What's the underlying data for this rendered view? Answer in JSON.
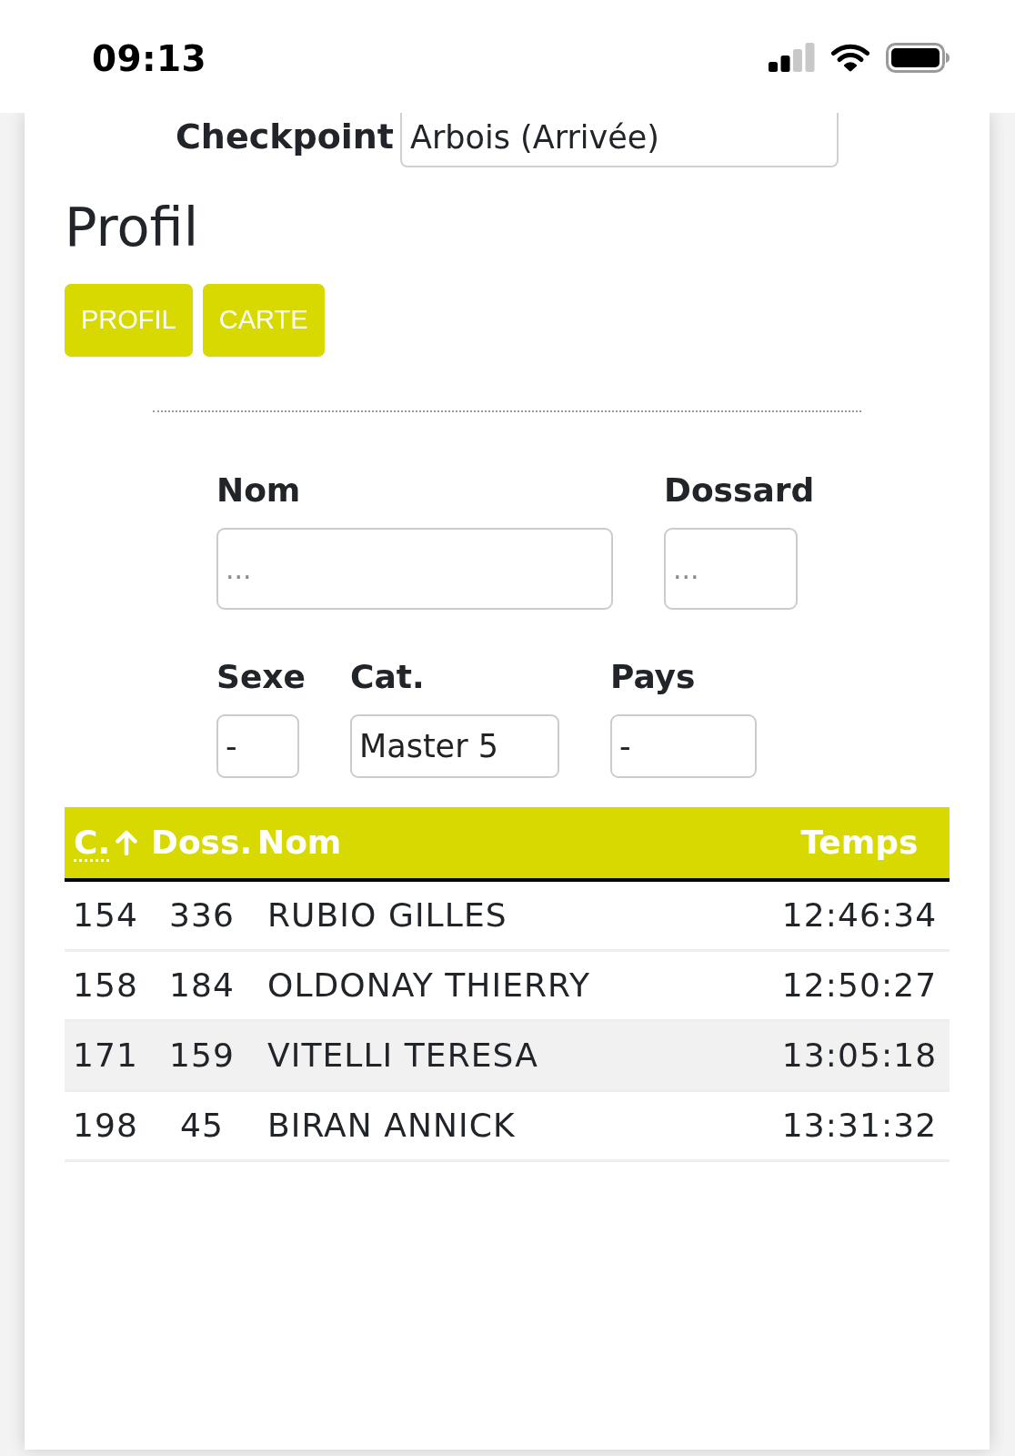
{
  "status_bar": {
    "time": "09:13"
  },
  "checkpoint": {
    "label": "Checkpoint",
    "value": "Arbois (Arrivée)"
  },
  "heading": "Profil",
  "view_buttons": [
    {
      "label": "PROFIL"
    },
    {
      "label": "CARTE"
    }
  ],
  "filters": [
    [
      {
        "kind": "input",
        "label": "Nom",
        "placeholder": "..."
      },
      {
        "kind": "input",
        "label": "Dossard",
        "placeholder": "..."
      }
    ],
    [
      {
        "kind": "select",
        "label": "Sexe",
        "value": "-"
      },
      {
        "kind": "select",
        "label": "Cat.",
        "value": "Master 5"
      },
      {
        "kind": "select",
        "label": "Pays",
        "value": "-"
      }
    ]
  ],
  "table": {
    "columns": [
      {
        "label": "C.",
        "abbr": true,
        "sorted": true
      },
      {
        "label": "Doss.",
        "abbr": false,
        "sorted": false
      },
      {
        "label": "Nom",
        "abbr": false,
        "sorted": false
      },
      {
        "label": "Temps",
        "abbr": false,
        "sorted": false
      }
    ],
    "rows": [
      {
        "cells": [
          "154",
          "336",
          "RUBIO GILLES",
          "12:46:34"
        ],
        "highlighted": false
      },
      {
        "cells": [
          "158",
          "184",
          "OLDONAY THIERRY",
          "12:50:27"
        ],
        "highlighted": false
      },
      {
        "cells": [
          "171",
          "159",
          "VITELLI TERESA",
          "13:05:18"
        ],
        "highlighted": true
      },
      {
        "cells": [
          "198",
          "45",
          "BIRAN ANNICK",
          "13:31:32"
        ],
        "highlighted": false
      }
    ]
  }
}
